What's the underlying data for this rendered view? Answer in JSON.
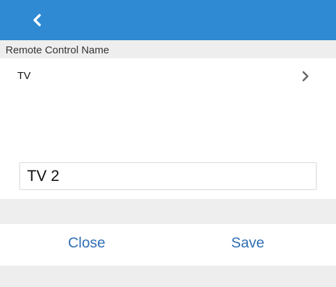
{
  "header": {
    "back_icon": "chevron-left-icon",
    "bar_color": "#2f8ad3"
  },
  "section": {
    "title": "Remote Control Name"
  },
  "item": {
    "label": "TV",
    "icon": "chevron-right-icon"
  },
  "dialog": {
    "input_value": "TV 2",
    "close_label": "Close",
    "save_label": "Save",
    "button_color": "#2f6fb5"
  }
}
